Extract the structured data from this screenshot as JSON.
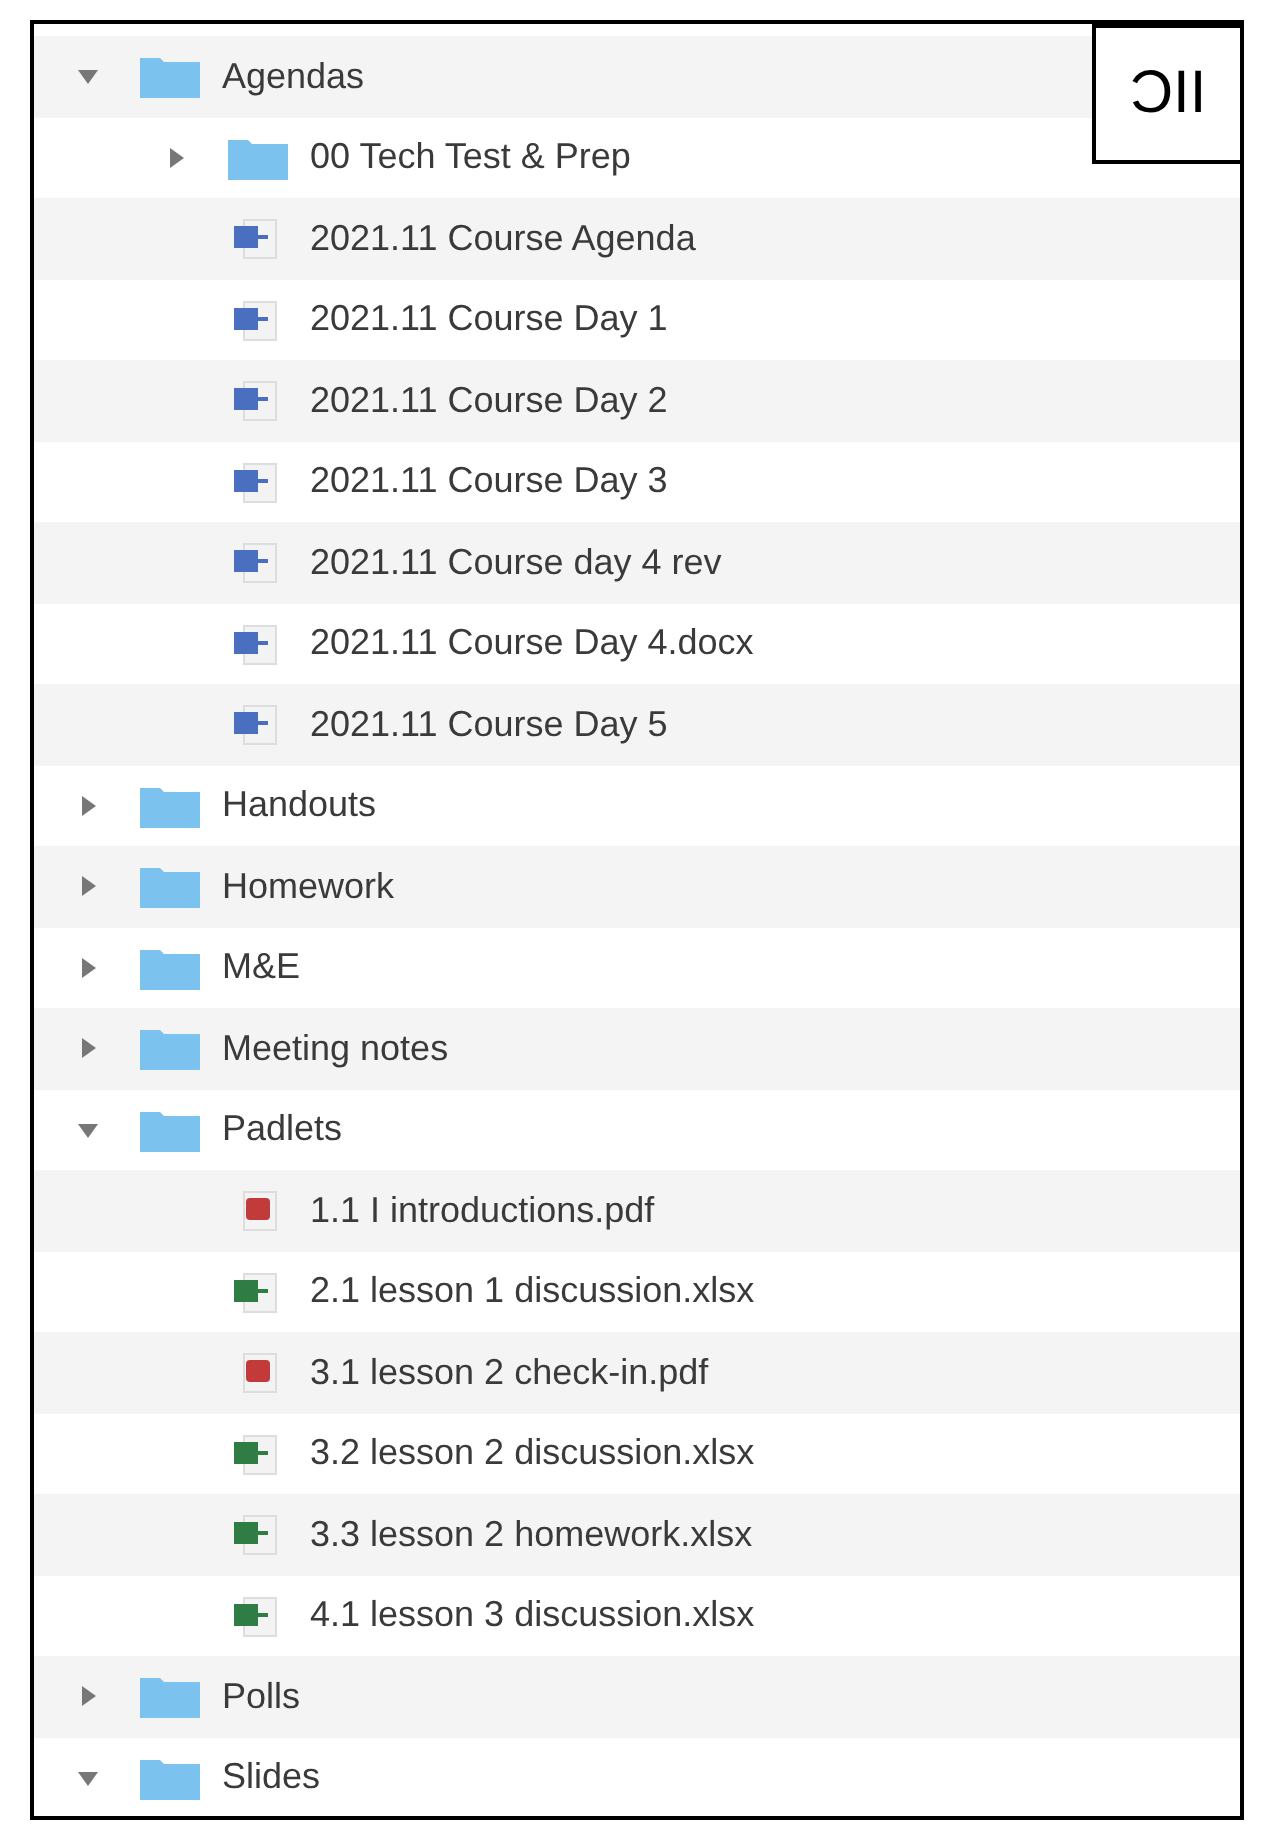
{
  "panel_label": "ƆII",
  "tree": [
    {
      "kind": "folder",
      "name": "Agendas",
      "expanded": true,
      "children": [
        {
          "kind": "folder",
          "name": "00 Tech Test & Prep",
          "expanded": false
        },
        {
          "kind": "doc",
          "name": "2021.11 Course Agenda"
        },
        {
          "kind": "doc",
          "name": "2021.11 Course Day 1"
        },
        {
          "kind": "doc",
          "name": "2021.11 Course Day 2"
        },
        {
          "kind": "doc",
          "name": "2021.11 Course Day 3"
        },
        {
          "kind": "doc",
          "name": "2021.11 Course day 4 rev"
        },
        {
          "kind": "doc",
          "name": "2021.11 Course Day 4.docx"
        },
        {
          "kind": "doc",
          "name": "2021.11 Course Day 5"
        }
      ]
    },
    {
      "kind": "folder",
      "name": "Handouts",
      "expanded": false
    },
    {
      "kind": "folder",
      "name": "Homework",
      "expanded": false
    },
    {
      "kind": "folder",
      "name": "M&E",
      "expanded": false
    },
    {
      "kind": "folder",
      "name": "Meeting notes",
      "expanded": false
    },
    {
      "kind": "folder",
      "name": "Padlets",
      "expanded": true,
      "children": [
        {
          "kind": "pdf",
          "name": "1.1 I introductions.pdf"
        },
        {
          "kind": "sheet",
          "name": "2.1 lesson 1 discussion.xlsx"
        },
        {
          "kind": "pdf",
          "name": "3.1 lesson 2 check-in.pdf"
        },
        {
          "kind": "sheet",
          "name": "3.2 lesson 2 discussion.xlsx"
        },
        {
          "kind": "sheet",
          "name": "3.3 lesson 2 homework.xlsx"
        },
        {
          "kind": "sheet",
          "name": "4.1 lesson 3 discussion.xlsx"
        }
      ]
    },
    {
      "kind": "folder",
      "name": "Polls",
      "expanded": false
    },
    {
      "kind": "folder",
      "name": "Slides",
      "expanded": true
    }
  ]
}
